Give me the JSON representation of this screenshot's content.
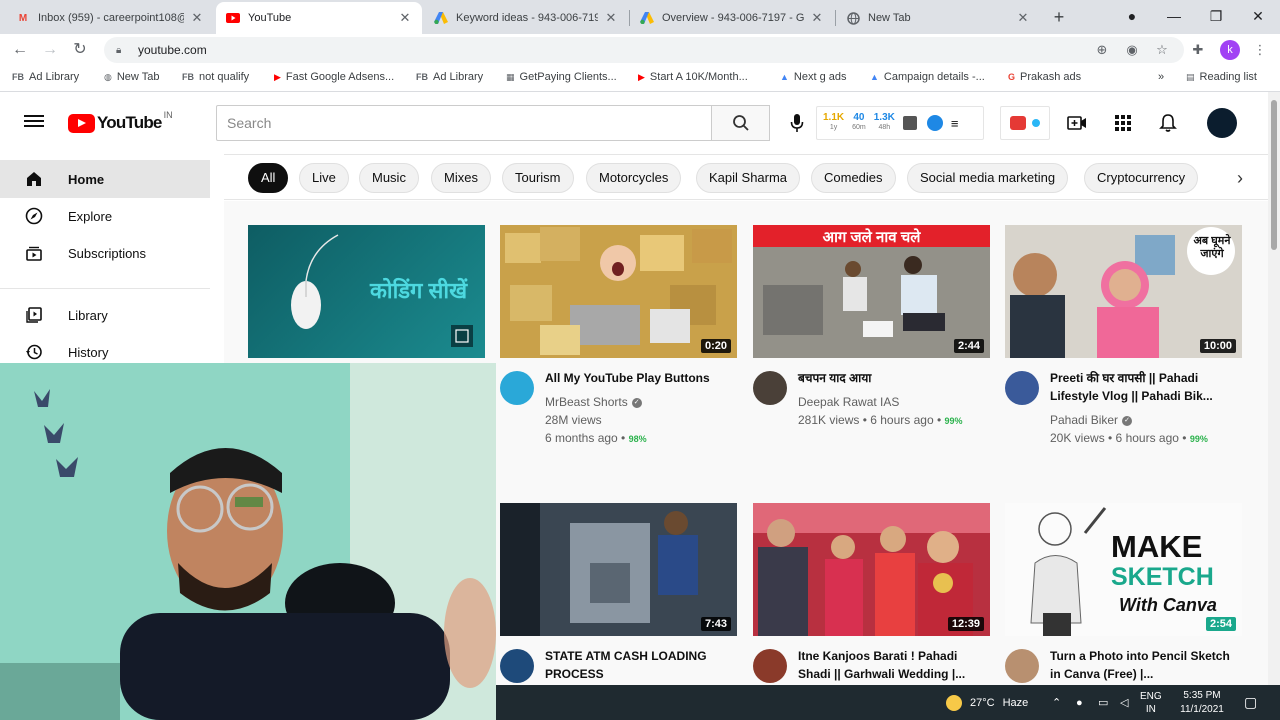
{
  "browser": {
    "tabs": [
      {
        "title": "Inbox (959) - careerpoint108@",
        "favicon": "gmail-icon"
      },
      {
        "title": "YouTube",
        "favicon": "youtube-icon"
      },
      {
        "title": "Keyword ideas - 943-006-7197",
        "favicon": "google-ads-icon"
      },
      {
        "title": "Overview - 943-006-7197 - G",
        "favicon": "google-ads-icon"
      },
      {
        "title": "New Tab",
        "favicon": "globe-icon"
      }
    ],
    "url": "youtube.com",
    "profile_letter": "k",
    "bookmarks": [
      {
        "prefix": "FB",
        "label": "Ad Library"
      },
      {
        "prefix": "",
        "label": "New Tab"
      },
      {
        "prefix": "FB",
        "label": "not qualify"
      },
      {
        "prefix": "",
        "label": "Fast Google Adsens..."
      },
      {
        "prefix": "FB",
        "label": "Ad Library"
      },
      {
        "prefix": "",
        "label": "GetPaying Clients..."
      },
      {
        "prefix": "",
        "label": "Start A 10K/Month..."
      },
      {
        "prefix": "",
        "label": "Next g ads"
      },
      {
        "prefix": "",
        "label": "Campaign details -..."
      },
      {
        "prefix": "",
        "label": "Prakash ads"
      }
    ],
    "reading_list": "Reading list"
  },
  "youtube": {
    "logo_text": "YouTube",
    "country_code": "IN",
    "search_placeholder": "Search",
    "ext_stats": [
      {
        "value": "1.1K",
        "unit": "1y",
        "color": "#e6a800"
      },
      {
        "value": "40",
        "unit": "60m",
        "color": "#1e88e5"
      },
      {
        "value": "1.3K",
        "unit": "48h",
        "color": "#1e88e5"
      }
    ],
    "sidebar": [
      {
        "label": "Home",
        "icon": "home-icon"
      },
      {
        "label": "Explore",
        "icon": "compass-icon"
      },
      {
        "label": "Subscriptions",
        "icon": "subscriptions-icon"
      },
      {
        "label": "Library",
        "icon": "library-icon"
      },
      {
        "label": "History",
        "icon": "history-icon"
      }
    ],
    "chips": [
      "All",
      "Live",
      "Music",
      "Mixes",
      "Tourism",
      "Motorcycles",
      "Kapil Sharma",
      "Comedies",
      "Social media marketing",
      "Cryptocurrency"
    ],
    "videos": [
      {
        "title": "",
        "channel": "",
        "stats": "",
        "duration": "",
        "thumb_text": "कोडिंग सीखें"
      },
      {
        "title": "All My YouTube Play Buttons",
        "channel": "MrBeast Shorts",
        "verified": true,
        "views": "28M views",
        "age": "6 months ago",
        "pct": "98%",
        "duration": "0:20"
      },
      {
        "title": "बचपन याद आया",
        "channel": "Deepak Rawat IAS",
        "verified": false,
        "views": "281K views • 6 hours ago",
        "age": "",
        "pct": "99%",
        "duration": "2:44",
        "thumb_text": "आग जले नाव चले"
      },
      {
        "title": "Preeti की घर वापसी || Pahadi Lifestyle Vlog || Pahadi Bik...",
        "channel": "Pahadi Biker",
        "verified": true,
        "views": "20K views • 6 hours ago",
        "age": "",
        "pct": "99%",
        "duration": "10:00",
        "thumb_text": "अब घूमने जाएंगे"
      },
      {
        "title": "STATE ATM CASH LOADING PROCESS",
        "channel": "",
        "duration": "7:43"
      },
      {
        "title": "Itne Kanjoos Barati ! Pahadi Shadi || Garhwali Wedding |...",
        "channel": "",
        "duration": "12:39"
      },
      {
        "title": "Turn a Photo into Pencil Sketch in Canva (Free) |...",
        "channel": "",
        "duration": "2:54",
        "thumb_text": [
          "MAKE",
          "SKETCH",
          "With Canva"
        ]
      }
    ]
  },
  "taskbar": {
    "temp": "27°C",
    "weather": "Haze",
    "lang1": "ENG",
    "lang2": "IN",
    "time": "5:35 PM",
    "date": "11/1/2021"
  }
}
